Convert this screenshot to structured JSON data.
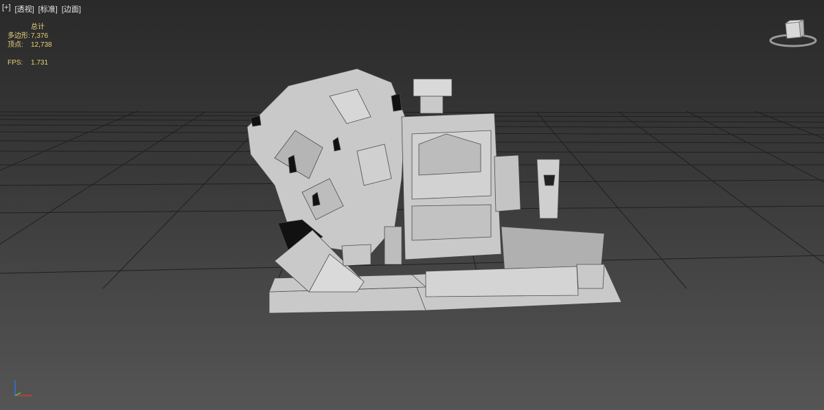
{
  "viewport_menu": {
    "plus": "[+]",
    "view": "[透视]",
    "shading": "[标准]",
    "style": "[边面]"
  },
  "stats": {
    "header": "总计",
    "polygons_label": "多边形:",
    "polygons_value": "7,376",
    "vertices_label": "顶点:",
    "vertices_value": "12,738",
    "fps_label": "FPS:",
    "fps_value": "1.731"
  },
  "colors": {
    "stats_text": "#e8d27a",
    "menu_text": "#e6e6e6",
    "grid_line": "#1e1e1e",
    "mesh_fill": "#c8c8c8",
    "mesh_edge": "#4a4a4a"
  },
  "icons": {
    "viewcube": "viewcube-icon",
    "axis": "axis-tripod-icon"
  }
}
